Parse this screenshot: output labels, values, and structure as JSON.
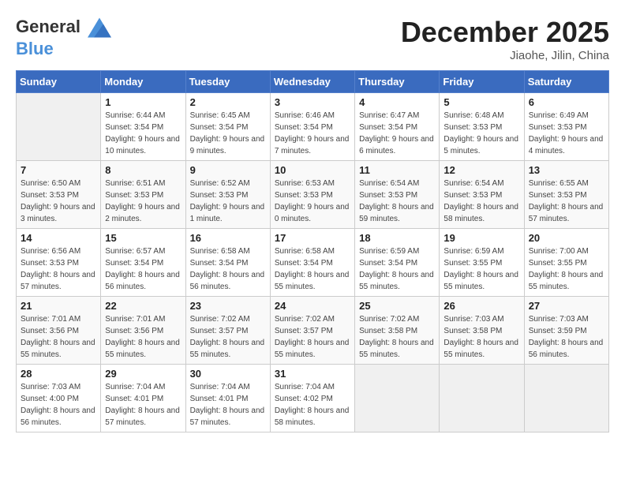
{
  "logo": {
    "general": "General",
    "blue": "Blue"
  },
  "header": {
    "month": "December 2025",
    "location": "Jiaohe, Jilin, China"
  },
  "days_of_week": [
    "Sunday",
    "Monday",
    "Tuesday",
    "Wednesday",
    "Thursday",
    "Friday",
    "Saturday"
  ],
  "weeks": [
    [
      {
        "day": "",
        "sunrise": "",
        "sunset": "",
        "daylight": "",
        "empty": true
      },
      {
        "day": "1",
        "sunrise": "Sunrise: 6:44 AM",
        "sunset": "Sunset: 3:54 PM",
        "daylight": "Daylight: 9 hours and 10 minutes."
      },
      {
        "day": "2",
        "sunrise": "Sunrise: 6:45 AM",
        "sunset": "Sunset: 3:54 PM",
        "daylight": "Daylight: 9 hours and 9 minutes."
      },
      {
        "day": "3",
        "sunrise": "Sunrise: 6:46 AM",
        "sunset": "Sunset: 3:54 PM",
        "daylight": "Daylight: 9 hours and 7 minutes."
      },
      {
        "day": "4",
        "sunrise": "Sunrise: 6:47 AM",
        "sunset": "Sunset: 3:54 PM",
        "daylight": "Daylight: 9 hours and 6 minutes."
      },
      {
        "day": "5",
        "sunrise": "Sunrise: 6:48 AM",
        "sunset": "Sunset: 3:53 PM",
        "daylight": "Daylight: 9 hours and 5 minutes."
      },
      {
        "day": "6",
        "sunrise": "Sunrise: 6:49 AM",
        "sunset": "Sunset: 3:53 PM",
        "daylight": "Daylight: 9 hours and 4 minutes."
      }
    ],
    [
      {
        "day": "7",
        "sunrise": "Sunrise: 6:50 AM",
        "sunset": "Sunset: 3:53 PM",
        "daylight": "Daylight: 9 hours and 3 minutes."
      },
      {
        "day": "8",
        "sunrise": "Sunrise: 6:51 AM",
        "sunset": "Sunset: 3:53 PM",
        "daylight": "Daylight: 9 hours and 2 minutes."
      },
      {
        "day": "9",
        "sunrise": "Sunrise: 6:52 AM",
        "sunset": "Sunset: 3:53 PM",
        "daylight": "Daylight: 9 hours and 1 minute."
      },
      {
        "day": "10",
        "sunrise": "Sunrise: 6:53 AM",
        "sunset": "Sunset: 3:53 PM",
        "daylight": "Daylight: 9 hours and 0 minutes."
      },
      {
        "day": "11",
        "sunrise": "Sunrise: 6:54 AM",
        "sunset": "Sunset: 3:53 PM",
        "daylight": "Daylight: 8 hours and 59 minutes."
      },
      {
        "day": "12",
        "sunrise": "Sunrise: 6:54 AM",
        "sunset": "Sunset: 3:53 PM",
        "daylight": "Daylight: 8 hours and 58 minutes."
      },
      {
        "day": "13",
        "sunrise": "Sunrise: 6:55 AM",
        "sunset": "Sunset: 3:53 PM",
        "daylight": "Daylight: 8 hours and 57 minutes."
      }
    ],
    [
      {
        "day": "14",
        "sunrise": "Sunrise: 6:56 AM",
        "sunset": "Sunset: 3:53 PM",
        "daylight": "Daylight: 8 hours and 57 minutes."
      },
      {
        "day": "15",
        "sunrise": "Sunrise: 6:57 AM",
        "sunset": "Sunset: 3:54 PM",
        "daylight": "Daylight: 8 hours and 56 minutes."
      },
      {
        "day": "16",
        "sunrise": "Sunrise: 6:58 AM",
        "sunset": "Sunset: 3:54 PM",
        "daylight": "Daylight: 8 hours and 56 minutes."
      },
      {
        "day": "17",
        "sunrise": "Sunrise: 6:58 AM",
        "sunset": "Sunset: 3:54 PM",
        "daylight": "Daylight: 8 hours and 55 minutes."
      },
      {
        "day": "18",
        "sunrise": "Sunrise: 6:59 AM",
        "sunset": "Sunset: 3:54 PM",
        "daylight": "Daylight: 8 hours and 55 minutes."
      },
      {
        "day": "19",
        "sunrise": "Sunrise: 6:59 AM",
        "sunset": "Sunset: 3:55 PM",
        "daylight": "Daylight: 8 hours and 55 minutes."
      },
      {
        "day": "20",
        "sunrise": "Sunrise: 7:00 AM",
        "sunset": "Sunset: 3:55 PM",
        "daylight": "Daylight: 8 hours and 55 minutes."
      }
    ],
    [
      {
        "day": "21",
        "sunrise": "Sunrise: 7:01 AM",
        "sunset": "Sunset: 3:56 PM",
        "daylight": "Daylight: 8 hours and 55 minutes."
      },
      {
        "day": "22",
        "sunrise": "Sunrise: 7:01 AM",
        "sunset": "Sunset: 3:56 PM",
        "daylight": "Daylight: 8 hours and 55 minutes."
      },
      {
        "day": "23",
        "sunrise": "Sunrise: 7:02 AM",
        "sunset": "Sunset: 3:57 PM",
        "daylight": "Daylight: 8 hours and 55 minutes."
      },
      {
        "day": "24",
        "sunrise": "Sunrise: 7:02 AM",
        "sunset": "Sunset: 3:57 PM",
        "daylight": "Daylight: 8 hours and 55 minutes."
      },
      {
        "day": "25",
        "sunrise": "Sunrise: 7:02 AM",
        "sunset": "Sunset: 3:58 PM",
        "daylight": "Daylight: 8 hours and 55 minutes."
      },
      {
        "day": "26",
        "sunrise": "Sunrise: 7:03 AM",
        "sunset": "Sunset: 3:58 PM",
        "daylight": "Daylight: 8 hours and 55 minutes."
      },
      {
        "day": "27",
        "sunrise": "Sunrise: 7:03 AM",
        "sunset": "Sunset: 3:59 PM",
        "daylight": "Daylight: 8 hours and 56 minutes."
      }
    ],
    [
      {
        "day": "28",
        "sunrise": "Sunrise: 7:03 AM",
        "sunset": "Sunset: 4:00 PM",
        "daylight": "Daylight: 8 hours and 56 minutes."
      },
      {
        "day": "29",
        "sunrise": "Sunrise: 7:04 AM",
        "sunset": "Sunset: 4:01 PM",
        "daylight": "Daylight: 8 hours and 57 minutes."
      },
      {
        "day": "30",
        "sunrise": "Sunrise: 7:04 AM",
        "sunset": "Sunset: 4:01 PM",
        "daylight": "Daylight: 8 hours and 57 minutes."
      },
      {
        "day": "31",
        "sunrise": "Sunrise: 7:04 AM",
        "sunset": "Sunset: 4:02 PM",
        "daylight": "Daylight: 8 hours and 58 minutes."
      },
      {
        "day": "",
        "sunrise": "",
        "sunset": "",
        "daylight": "",
        "empty": true
      },
      {
        "day": "",
        "sunrise": "",
        "sunset": "",
        "daylight": "",
        "empty": true
      },
      {
        "day": "",
        "sunrise": "",
        "sunset": "",
        "daylight": "",
        "empty": true
      }
    ]
  ]
}
